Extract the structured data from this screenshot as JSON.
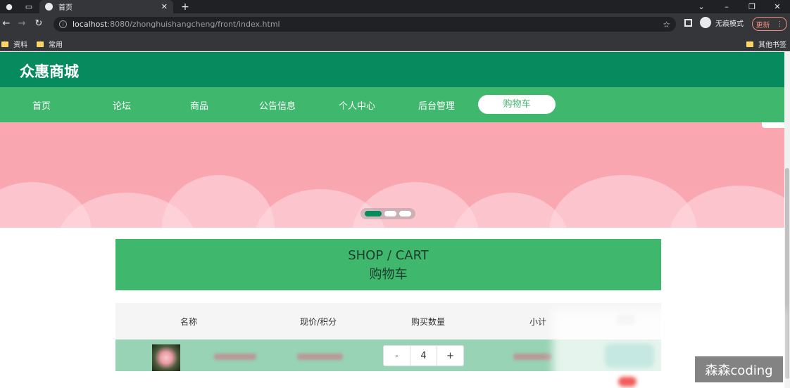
{
  "browser": {
    "tab_title": "首页",
    "url_host": "localhost",
    "url_path": ":8080/zhonghuishangcheng/front/index.html",
    "incognito_label": "无痕模式",
    "update_label": "更新",
    "bookmarks": [
      "资料",
      "常用"
    ],
    "other_bookmarks": "其他书签"
  },
  "site": {
    "logo": "众惠商城",
    "nav": [
      "首页",
      "论坛",
      "商品",
      "公告信息",
      "个人中心",
      "后台管理",
      "购物车"
    ],
    "active_nav": "购物车"
  },
  "cart": {
    "title_en": "SHOP / CART",
    "title_cn": "购物车",
    "headers": [
      "名称",
      "现价/积分",
      "购买数量",
      "小计"
    ],
    "rows": [
      {
        "quantity": "4",
        "decrement": "-",
        "increment": "+"
      }
    ]
  },
  "watermark": "森森coding",
  "colors": {
    "header_dark": "#068a5e",
    "nav_green": "#3fb76c",
    "banner_pink": "#fba6b1",
    "row_green": "#97d3b4"
  }
}
